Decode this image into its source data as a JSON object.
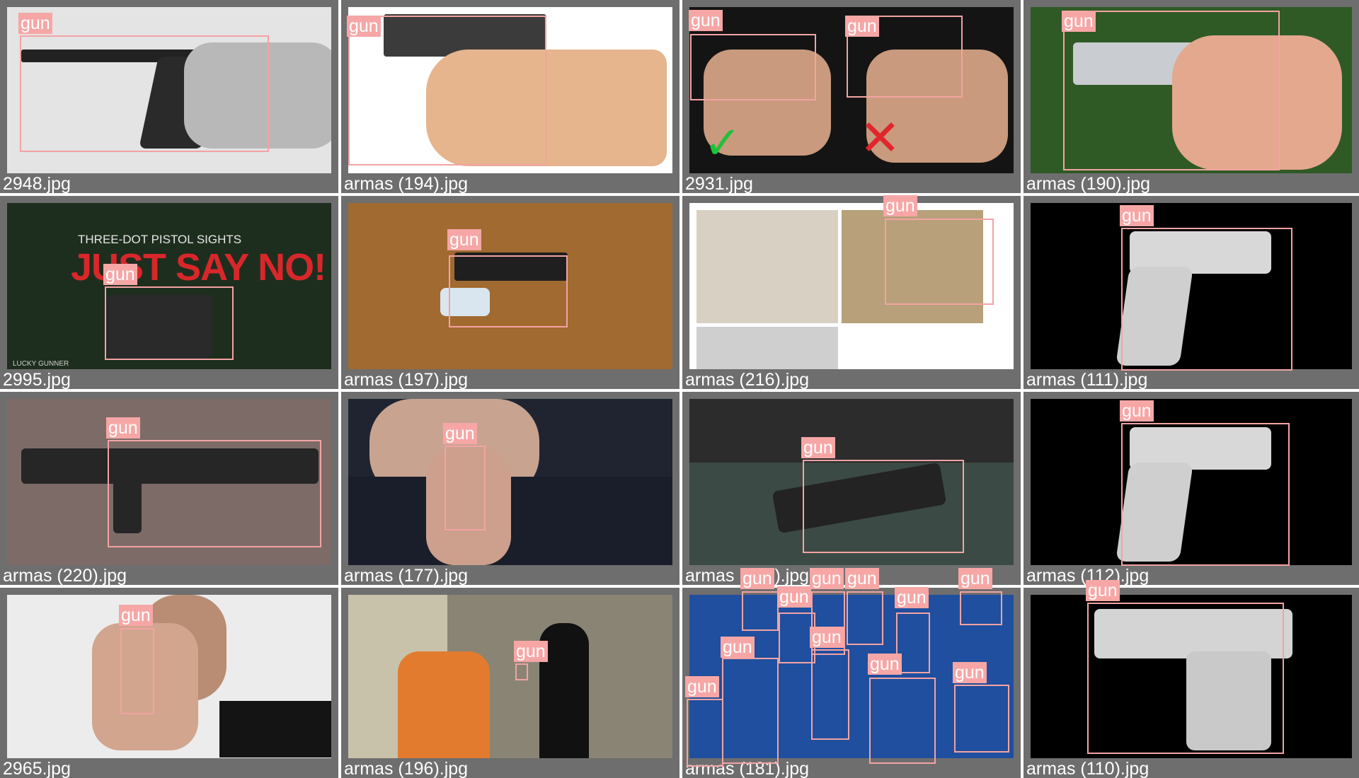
{
  "palette": {
    "box": "#f3a3a3",
    "label_bg": "#f7a6a6",
    "label_text": "#ffffff",
    "tile_bg": "#6e6e6e",
    "filename_text": "#ffffff"
  },
  "detection_class": "gun",
  "tiles": [
    {
      "filename": "2948.jpg"
    },
    {
      "filename": "armas (194).jpg"
    },
    {
      "filename": "2931.jpg"
    },
    {
      "filename": "armas (190).jpg"
    },
    {
      "filename": "2995.jpg",
      "banner_line1": "THREE-DOT PISTOL SIGHTS",
      "banner_line2": "JUST SAY NO!",
      "brand": "LUCKY GUNNER"
    },
    {
      "filename": "armas (197).jpg"
    },
    {
      "filename": "armas (216).jpg"
    },
    {
      "filename": "armas (111).jpg"
    },
    {
      "filename": "armas (220).jpg"
    },
    {
      "filename": "armas (177).jpg"
    },
    {
      "filename": "armas (177).jpg"
    },
    {
      "filename": "armas (112).jpg"
    },
    {
      "filename": "2965.jpg"
    },
    {
      "filename": "armas (196).jpg"
    },
    {
      "filename": "armas (181).jpg"
    },
    {
      "filename": "armas (110).jpg"
    }
  ]
}
